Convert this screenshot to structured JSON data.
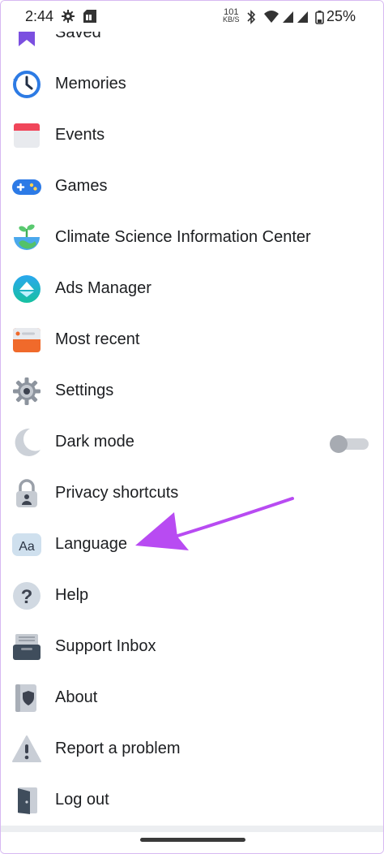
{
  "status_bar": {
    "time": "2:44",
    "net_speed_value": "101",
    "net_speed_unit": "KB/S",
    "battery": "25%"
  },
  "menu": {
    "items": [
      {
        "label": "Saved",
        "icon": "bookmark-icon"
      },
      {
        "label": "Memories",
        "icon": "clock-history-icon"
      },
      {
        "label": "Events",
        "icon": "calendar-icon"
      },
      {
        "label": "Games",
        "icon": "gamepad-icon"
      },
      {
        "label": "Climate Science Information Center",
        "icon": "plant-globe-icon"
      },
      {
        "label": "Ads Manager",
        "icon": "ads-manager-icon"
      },
      {
        "label": "Most recent",
        "icon": "feed-icon"
      },
      {
        "label": "Settings",
        "icon": "gear-icon"
      },
      {
        "label": "Dark mode",
        "icon": "moon-icon",
        "toggle": "off"
      },
      {
        "label": "Privacy shortcuts",
        "icon": "lock-icon"
      },
      {
        "label": "Language",
        "icon": "language-icon"
      },
      {
        "label": "Help",
        "icon": "question-icon"
      },
      {
        "label": "Support Inbox",
        "icon": "inbox-icon"
      },
      {
        "label": "About",
        "icon": "book-shield-icon"
      },
      {
        "label": "Report a problem",
        "icon": "warning-icon"
      },
      {
        "label": "Log out",
        "icon": "door-icon"
      }
    ]
  },
  "annotation": {
    "type": "purple arrow pointing to Language",
    "color": "#b84bf2"
  }
}
